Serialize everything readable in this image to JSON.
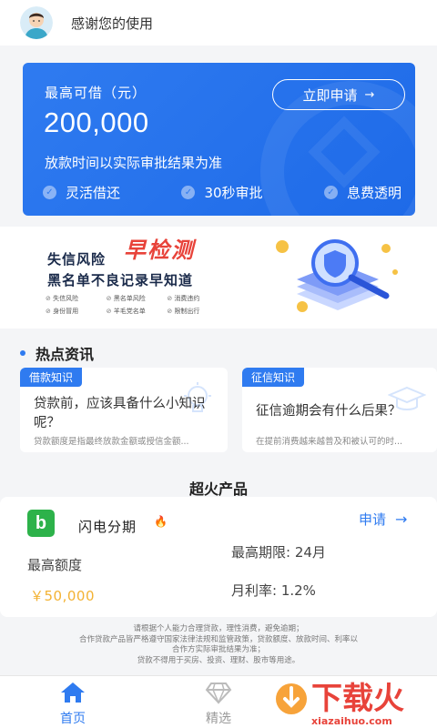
{
  "header": {
    "title": "感谢您的使用"
  },
  "hero": {
    "label": "最高可借（元）",
    "amount": "200,000",
    "note": "放款时间以实际审批结果为准",
    "apply_label": "立即申请",
    "features": [
      "灵活借还",
      "30秒审批",
      "息费透明"
    ]
  },
  "banner": {
    "line1": "失信风险",
    "highlight": "早检测",
    "line2": "黑名单不良记录早知道",
    "tags": [
      "失信风险",
      "黑名单风险",
      "消费违约",
      "身份冒用",
      "羊毛党名单",
      "限制出行"
    ]
  },
  "news": {
    "section_title": "热点资讯",
    "items": [
      {
        "tag": "借款知识",
        "title": "贷款前，应该具备什么小知识呢？",
        "summary": "贷款额度是指最终放款金额或授信金额..."
      },
      {
        "tag": "征信知识",
        "title": "征信逾期会有什么后果？",
        "summary": "在提前消费越来越普及和被认可的时..."
      }
    ]
  },
  "products": {
    "section_title": "超火产品",
    "items": [
      {
        "logo_letter": "b",
        "name": "闪电分期",
        "apply_label": "申请",
        "limit_label": "最高额度",
        "limit_value": "￥50,000",
        "term": "最高期限: 24月",
        "rate": "月利率: 1.2%"
      }
    ]
  },
  "disclaimer": [
    "请根据个人能力合理贷款，理性消费，避免逾期；",
    "合作贷款产品皆严格遵守国家法律法规和监管政策，贷款额度、放款时间、利率以",
    "合作方实际审批结果为准；",
    "贷款不得用于买房、投资、理财、股市等用途。"
  ],
  "tabbar": {
    "home": "首页",
    "featured": "精选"
  },
  "watermark": {
    "text": "下载火",
    "site": "xiazaihuo.com"
  },
  "colors": {
    "primary": "#2f7bf0",
    "accent": "#f3b233",
    "brand_green": "#2db24a",
    "watermark_red": "#e8433a"
  }
}
